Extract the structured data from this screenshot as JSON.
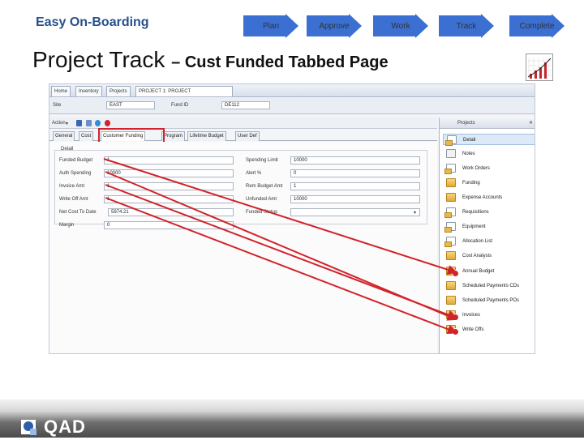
{
  "brand": "Easy On-Boarding",
  "process_steps": [
    "Plan",
    "Approve",
    "Work",
    "Track",
    "Complete"
  ],
  "title": {
    "main": "Project Track",
    "sub": "– Cust Funded Tabbed Page"
  },
  "window": {
    "tabs": [
      "Home",
      "Inventory",
      "Projects",
      "PROJECT 1: PROJECT"
    ],
    "header": {
      "site_label": "Site",
      "site_value": "EAST",
      "fund_label": "Fund ID",
      "fund_value": "DE112"
    },
    "action_label": "Action",
    "inner_tabs": [
      "General",
      "Cost",
      "Customer Funding",
      "Program",
      "Lifetime Budget",
      "User Def"
    ],
    "detail_label": "Detail",
    "left_fields": [
      {
        "label": "Funded Budget",
        "value": "1"
      },
      {
        "label": "Auth Spending",
        "value": "10000"
      },
      {
        "label": "Invoice Amt",
        "value": "1"
      },
      {
        "label": "Write Off Amt",
        "value": "1"
      },
      {
        "label": "Net Cost To Date",
        "value": "5974.21"
      },
      {
        "label": "Margin",
        "value": "0"
      }
    ],
    "right_fields": [
      {
        "label": "Spending Limit",
        "value": "10000"
      },
      {
        "label": "Alert %",
        "value": "0"
      },
      {
        "label": "Rem Budget Amt",
        "value": "1"
      },
      {
        "label": "Unfunded Amt",
        "value": "10000"
      },
      {
        "label": "Funded Status",
        "value": ""
      }
    ],
    "side_panel": {
      "title": "Projects",
      "items": [
        "Detail",
        "Notes",
        "Work Orders",
        "Funding",
        "Expense Accounts",
        "Requisitions",
        "Equipment",
        "Allocation List",
        "Cost Analysis",
        "Annual Budget",
        "Scheduled Payments CDs",
        "Scheduled Payments POs",
        "Invoices",
        "Write Offs"
      ]
    }
  },
  "footer": {
    "logo_text": "QAD"
  },
  "colors": {
    "accent": "#27508c",
    "highlight": "#d2232a",
    "arrow_fill": "#3b6fd1"
  }
}
